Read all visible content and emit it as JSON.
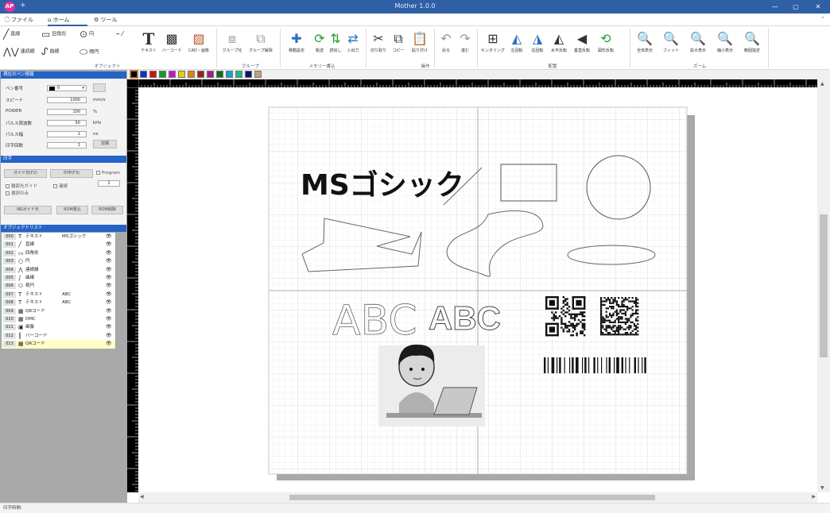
{
  "title_bar": {
    "badge": "AP",
    "title": "Mother 1.0.0",
    "minimize": "—",
    "maximize": "▢",
    "close": "✕"
  },
  "tabs": [
    {
      "label": "ファイル"
    },
    {
      "label": "ホーム"
    },
    {
      "label": "ツール"
    }
  ],
  "ribbon": {
    "draw_items": [
      "直線",
      "四角形",
      "円",
      "連続線",
      "曲線",
      "楕円"
    ],
    "buttons": [
      "テキスト",
      "バーコード",
      "CAD・画像",
      "グループ化",
      "グループ解除",
      "移動設定",
      "転送",
      "読出し",
      "入出力",
      "切り取り",
      "コピー",
      "貼り付け",
      "戻る",
      "進む",
      "センタリング",
      "左回転",
      "右回転",
      "水平反転",
      "垂直反転",
      "図形反転",
      "全体表示",
      "フィット",
      "拡大表示",
      "縮小表示",
      "範囲指定"
    ],
    "groups": [
      "オブジェクト",
      "グループ",
      "メモリー書込",
      "操作",
      "配置",
      "ズーム"
    ]
  },
  "palette": [
    "#000000",
    "#1030c8",
    "#d01010",
    "#10a020",
    "#d010d0",
    "#e8d000",
    "#e88000",
    "#a02020",
    "#a02080",
    "#107010",
    "#10a0e0",
    "#10c080",
    "#101070",
    "#c0a080"
  ],
  "left_panel": {
    "pen_section": {
      "title": "現在のペン情報",
      "rows": [
        {
          "label": "ペン番号",
          "value": "0",
          "unit": ""
        },
        {
          "label": "スピード",
          "value": "1000",
          "unit": "mm/s"
        },
        {
          "label": "POWER",
          "value": "100",
          "unit": "%"
        },
        {
          "label": "パルス周波数",
          "value": "50",
          "unit": "kHz"
        },
        {
          "label": "パルス幅",
          "value": "1",
          "unit": "ns"
        },
        {
          "label": "印字回数",
          "value": "1",
          "unit": ""
        }
      ],
      "detail_button": "詳細"
    },
    "print_section": {
      "title": "印字",
      "guide_button": "ガイド光(F2)",
      "print_button": "印字(F3)",
      "program_label": "Program",
      "program_value": "1",
      "checks": [
        "輪郭光ガイド",
        "選択のみ",
        "連続"
      ],
      "buttons": [
        "NGガイド光",
        "ROM書込",
        "ROM削除"
      ]
    },
    "objlist_section": {
      "title": "オブジェクトリスト",
      "items": [
        {
          "num": "000",
          "icon": "T",
          "type": "テキスト",
          "name": "MSゴシック"
        },
        {
          "num": "001",
          "icon": "╱",
          "type": "直線",
          "name": ""
        },
        {
          "num": "002",
          "icon": "▭",
          "type": "四角形",
          "name": ""
        },
        {
          "num": "003",
          "icon": "○",
          "type": "円",
          "name": ""
        },
        {
          "num": "004",
          "icon": "⋀",
          "type": "連続線",
          "name": ""
        },
        {
          "num": "005",
          "icon": "∫",
          "type": "曲線",
          "name": ""
        },
        {
          "num": "006",
          "icon": "⬭",
          "type": "楕円",
          "name": ""
        },
        {
          "num": "007",
          "icon": "T",
          "type": "テキスト",
          "name": "ABC"
        },
        {
          "num": "008",
          "icon": "T",
          "type": "テキスト",
          "name": "ABC"
        },
        {
          "num": "009",
          "icon": "▦",
          "type": "QRコード",
          "name": ""
        },
        {
          "num": "010",
          "icon": "▦",
          "type": "DMC",
          "name": ""
        },
        {
          "num": "011",
          "icon": "▣",
          "type": "画像",
          "name": ""
        },
        {
          "num": "012",
          "icon": "║",
          "type": "バーコード",
          "name": ""
        },
        {
          "num": "013",
          "icon": "▦",
          "type": "QRコード",
          "name": ""
        }
      ]
    }
  },
  "canvas": {
    "text_mincho": "MSゴシック",
    "text_abc_thin": "ABC",
    "text_abc_outline": "ABC"
  },
  "status": {
    "text": "印字時間:"
  }
}
